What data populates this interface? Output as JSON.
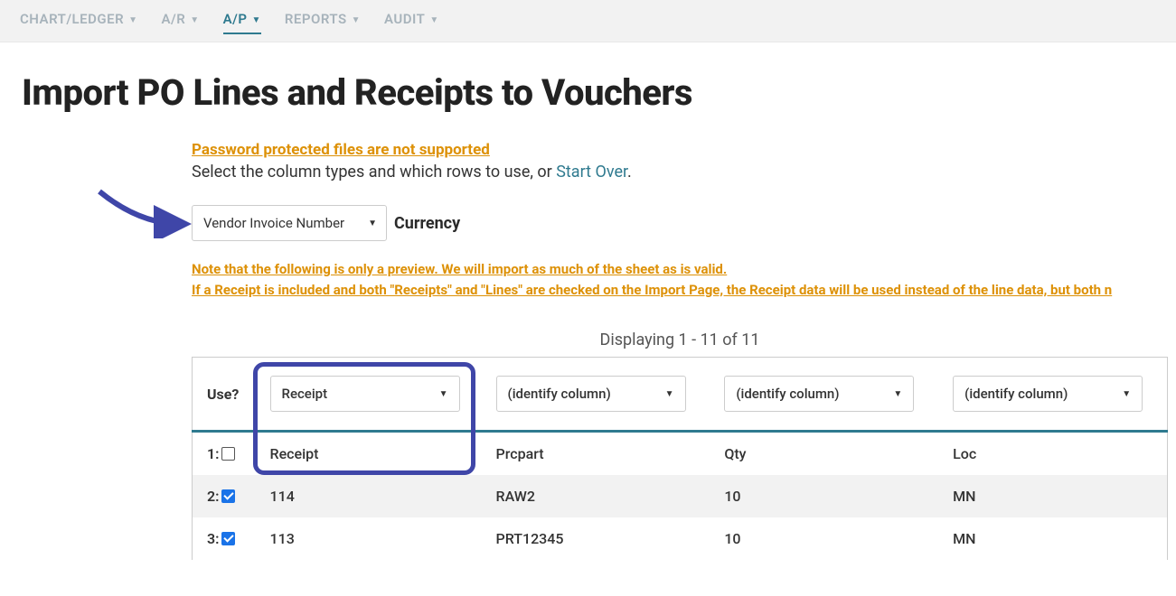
{
  "nav": {
    "items": [
      {
        "label": "CHART/LEDGER",
        "active": false
      },
      {
        "label": "A/R",
        "active": false
      },
      {
        "label": "A/P",
        "active": true
      },
      {
        "label": "REPORTS",
        "active": false
      },
      {
        "label": "AUDIT",
        "active": false
      }
    ]
  },
  "page": {
    "title": "Import PO Lines and Receipts to Vouchers",
    "password_warning": "Password protected files are not supported",
    "instruction_prefix": "Select the column types and which rows to use, or ",
    "start_over": "Start Over",
    "instruction_suffix": ".",
    "top_select": {
      "value": "Vendor Invoice Number"
    },
    "top_select_label": "Currency",
    "preview_note1": "Note that the following is only a preview. We will import as much of the sheet as is valid.",
    "preview_note2": "If a Receipt is included and both \"Receipts\" and \"Lines\" are checked on the Import Page, the Receipt data will be used instead of the line data, but both n",
    "display_count": "Displaying 1 - 11 of 11"
  },
  "table": {
    "use_header": "Use?",
    "col_dropdowns": [
      {
        "value": "Receipt"
      },
      {
        "value": "(identify column)"
      },
      {
        "value": "(identify column)"
      },
      {
        "value": "(identify column)"
      }
    ],
    "rows": [
      {
        "idx": "1:",
        "checked": false,
        "cells": [
          "Receipt",
          "Prcpart",
          "Qty",
          "Loc"
        ]
      },
      {
        "idx": "2:",
        "checked": true,
        "cells": [
          "114",
          "RAW2",
          "10",
          "MN"
        ]
      },
      {
        "idx": "3:",
        "checked": true,
        "cells": [
          "113",
          "PRT12345",
          "10",
          "MN"
        ]
      }
    ]
  }
}
